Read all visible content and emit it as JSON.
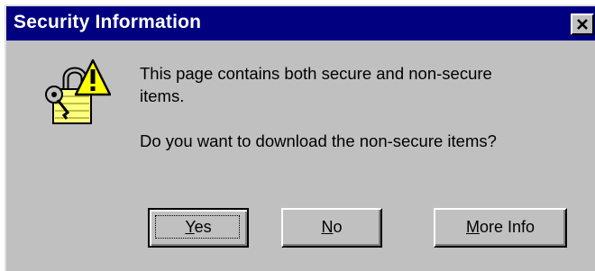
{
  "window": {
    "title": "Security Information",
    "close_icon": "close-icon",
    "colors": {
      "titlebar": "#000080",
      "face": "#c0c0c0",
      "title_text": "#ffffff"
    }
  },
  "icon": {
    "name": "warning-lock-icon",
    "colors": {
      "warning": "#ffff00",
      "lock": "#ffff80"
    }
  },
  "message": {
    "line1": "This page contains both secure and non-secure",
    "line2": "items.",
    "question": "Do you want to download the non-secure items?"
  },
  "buttons": {
    "yes": {
      "mnemonic": "Y",
      "rest": "es",
      "default": true
    },
    "no": {
      "mnemonic": "N",
      "rest": "o"
    },
    "more_info": {
      "mnemonic": "M",
      "rest": "ore Info"
    }
  }
}
